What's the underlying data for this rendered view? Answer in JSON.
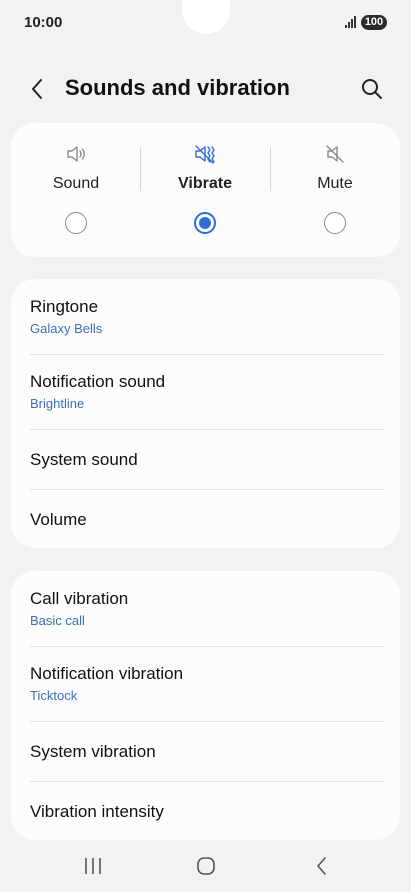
{
  "status_bar": {
    "time": "10:00",
    "battery": "100"
  },
  "header": {
    "title": "Sounds and vibration"
  },
  "sound_modes": [
    {
      "label": "Sound",
      "icon": "speaker-icon",
      "selected": false
    },
    {
      "label": "Vibrate",
      "icon": "vibrate-icon",
      "selected": true
    },
    {
      "label": "Mute",
      "icon": "mute-icon",
      "selected": false
    }
  ],
  "sound_settings": [
    {
      "label": "Ringtone",
      "value": "Galaxy Bells"
    },
    {
      "label": "Notification sound",
      "value": "Brightline"
    },
    {
      "label": "System sound",
      "value": ""
    },
    {
      "label": "Volume",
      "value": ""
    }
  ],
  "vibration_settings": [
    {
      "label": "Call vibration",
      "value": "Basic call"
    },
    {
      "label": "Notification vibration",
      "value": "Ticktock"
    },
    {
      "label": "System vibration",
      "value": ""
    },
    {
      "label": "Vibration intensity",
      "value": ""
    }
  ],
  "colors": {
    "accent": "#2e6bd6",
    "subtext": "#3e6fb5",
    "background": "#f2f2f4",
    "card": "#fcfcfd"
  }
}
